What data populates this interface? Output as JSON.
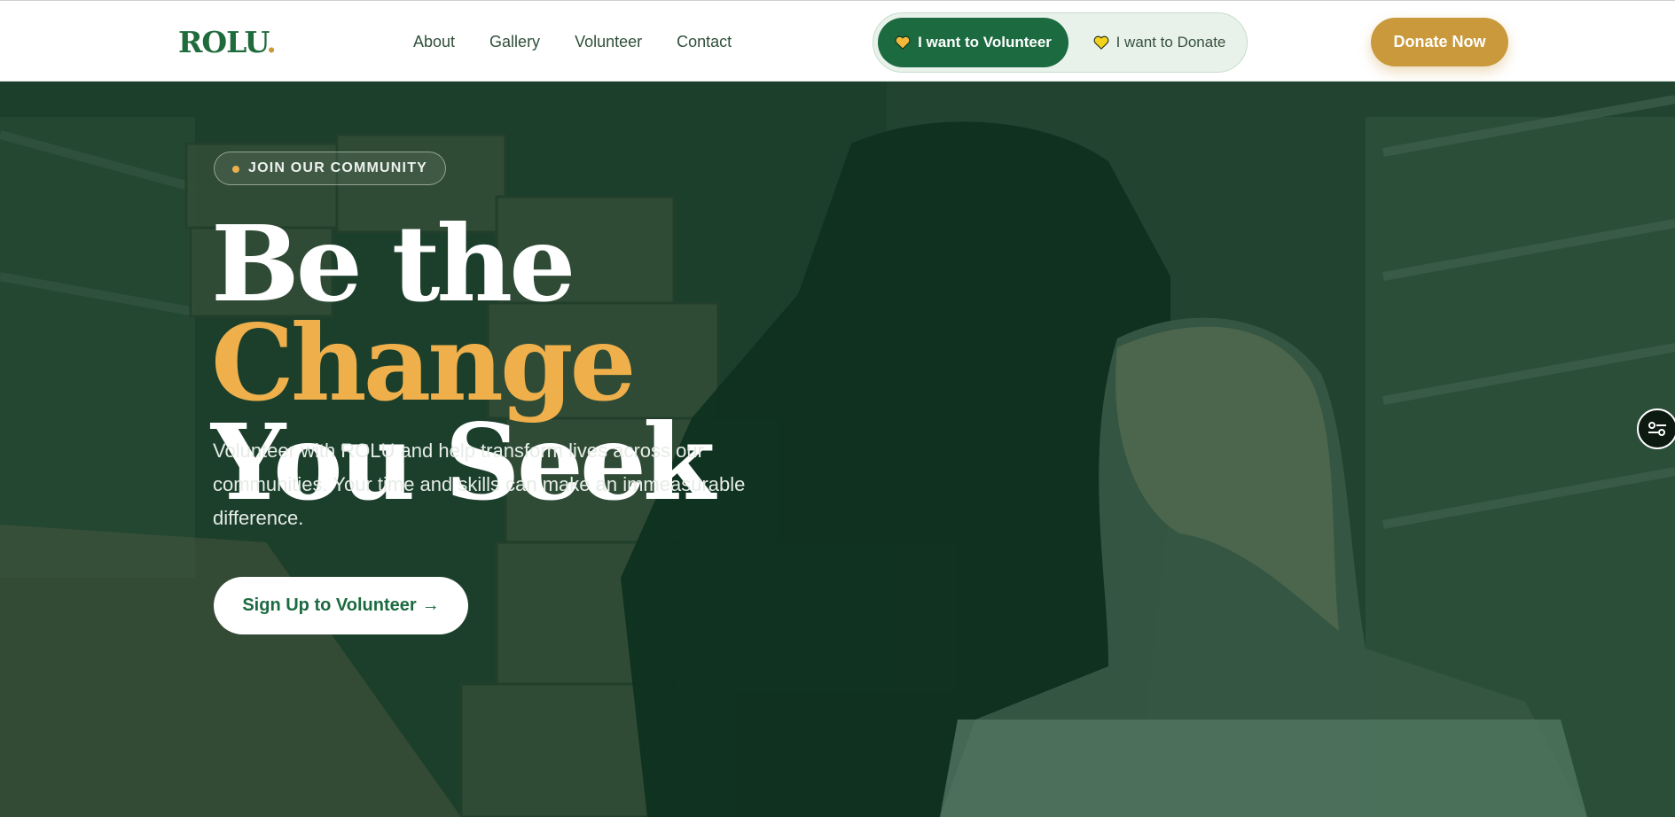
{
  "header": {
    "logo": {
      "left": "ROLU",
      "right": "."
    },
    "nav": [
      "About",
      "Gallery",
      "Volunteer",
      "Contact"
    ],
    "toggle": {
      "volunteer_label": "I want to Volunteer",
      "donate_label": "I want to Donate",
      "selected": "volunteer"
    },
    "donate_now_label": "Donate Now"
  },
  "hero": {
    "badge": "JOIN OUR COMMUNITY",
    "headline": {
      "part1": "Be the ",
      "highlight": "Change",
      "line2": "You Seek"
    },
    "lead": "Volunteer with ROLU and help transform lives across our communities. Your time and skills can make an immeasurable difference.",
    "cta_label": "Sign Up to Volunteer",
    "cta_arrow": "→"
  },
  "colors": {
    "brand_green": "#1c6a40",
    "brand_gold": "#c9993c",
    "headline_gold": "#efb04c",
    "toggle_bg": "#e8f2ea"
  },
  "icons": [
    "heart-icon",
    "arrow-right-icon",
    "settings-sliders-icon"
  ]
}
